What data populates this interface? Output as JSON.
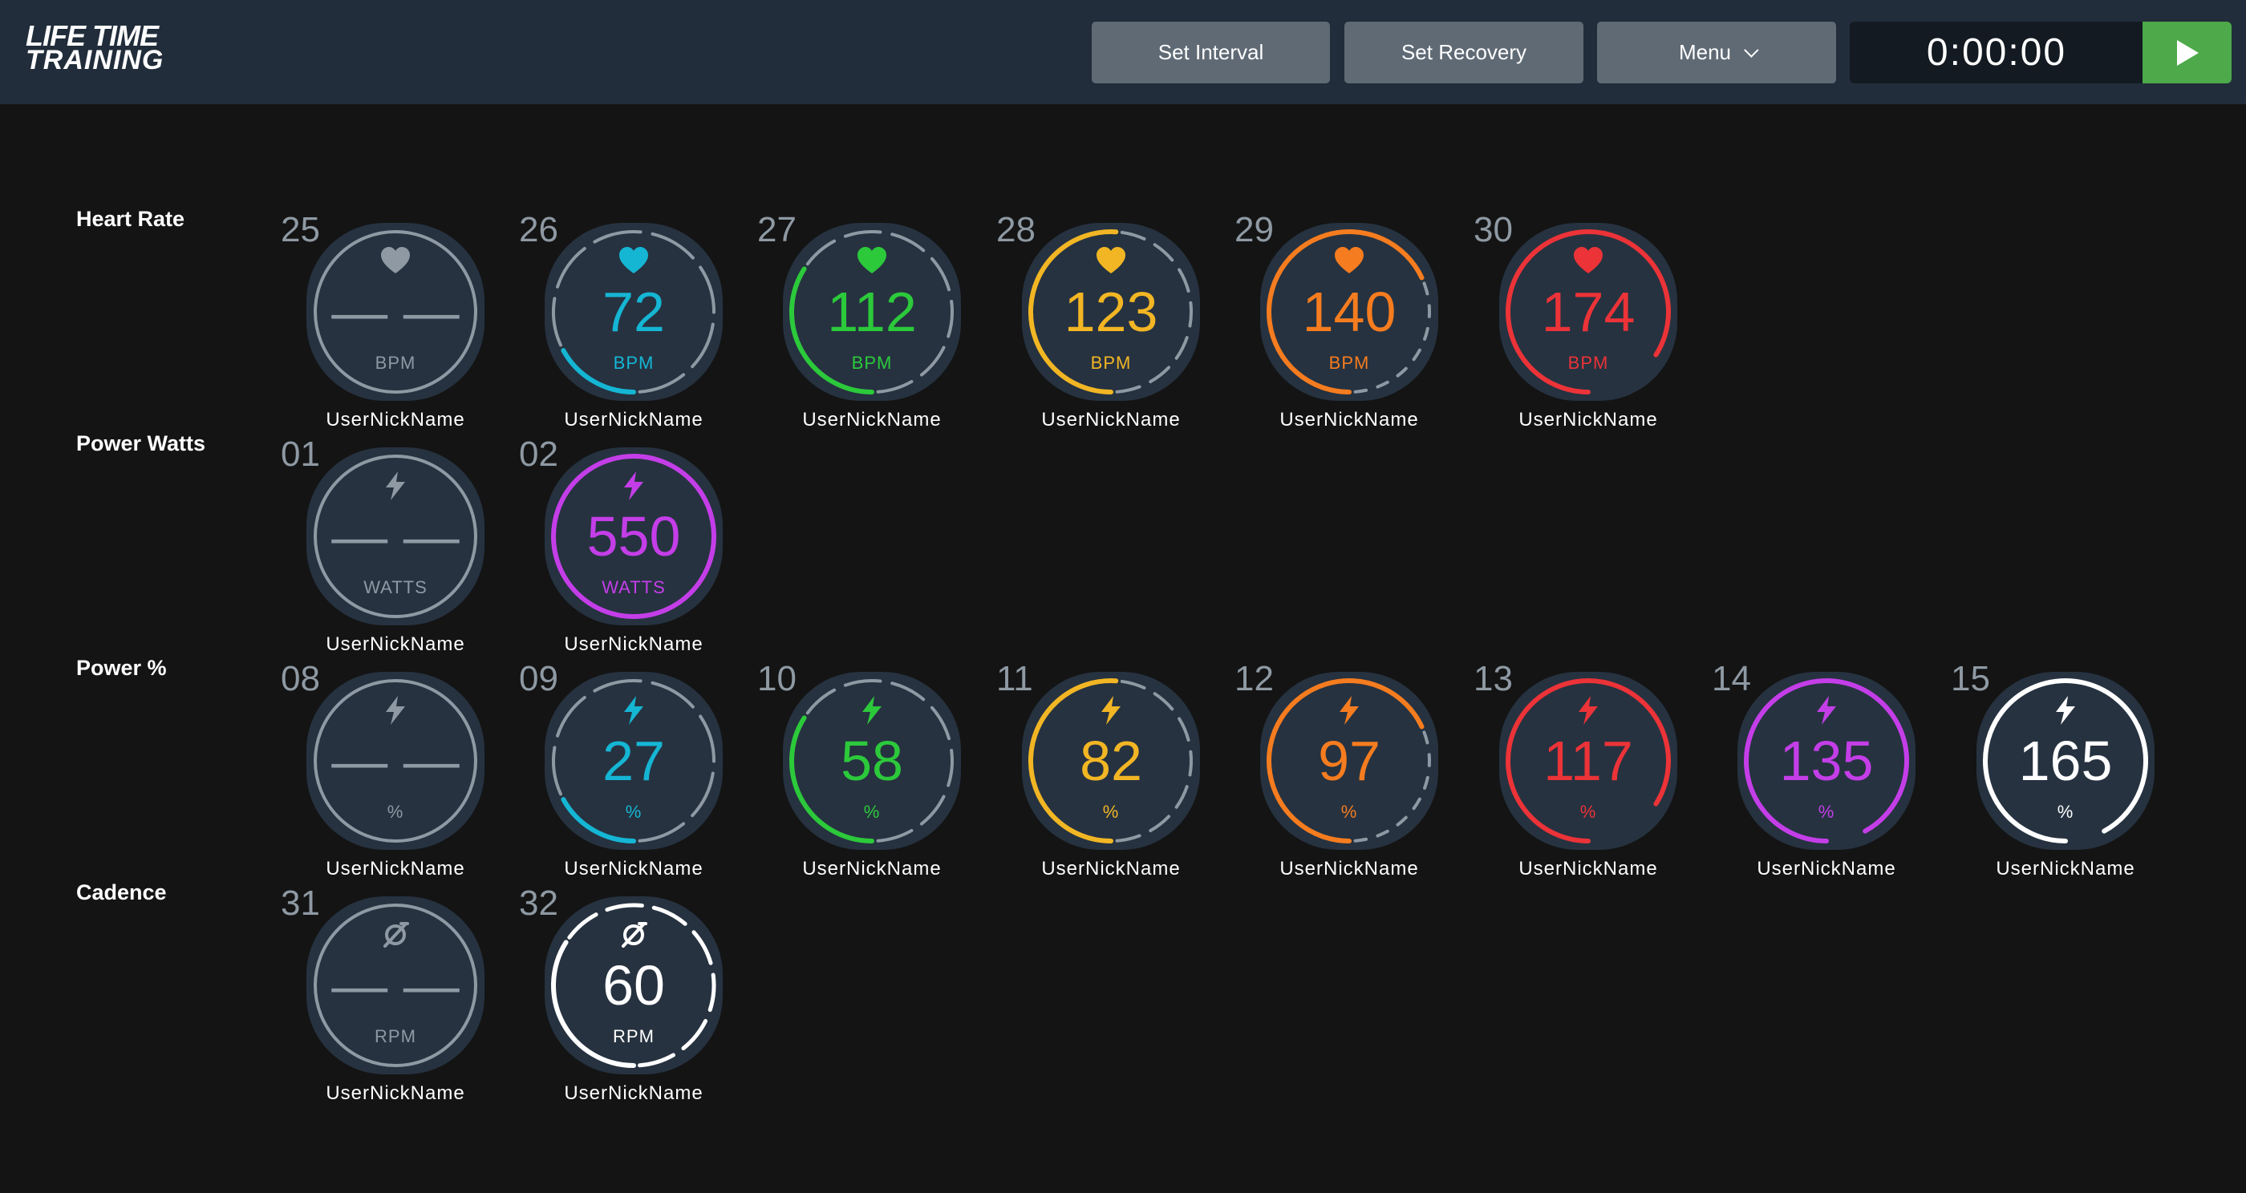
{
  "header": {
    "logo_line1": "LIFE TIME",
    "logo_line2": "TRAINING",
    "set_interval_label": "Set Interval",
    "set_recovery_label": "Set Recovery",
    "menu_label": "Menu",
    "timer": "0:00:00"
  },
  "colors": {
    "topbar": "#212d3a",
    "background": "#141414",
    "gray": "#8e99a3",
    "blue": "#15b6d4",
    "green": "#2cc93b",
    "yellow": "#f2b624",
    "orange": "#f57c1f",
    "red": "#eb3338",
    "purple": "#c43ee8",
    "white": "#ffffff",
    "play": "#4da94a"
  },
  "rows": [
    {
      "label": "Heart Rate",
      "icon": "heart-icon",
      "tiles": [
        {
          "number": "25",
          "value": "— —",
          "unit": "BPM",
          "name": "UserNickName",
          "color": "gray",
          "progress": 0
        },
        {
          "number": "26",
          "value": "72",
          "unit": "BPM",
          "name": "UserNickName",
          "color": "blue",
          "progress": 0.17
        },
        {
          "number": "27",
          "value": "112",
          "unit": "BPM",
          "name": "UserNickName",
          "color": "green",
          "progress": 0.34
        },
        {
          "number": "28",
          "value": "123",
          "unit": "BPM",
          "name": "UserNickName",
          "color": "yellow",
          "progress": 0.51
        },
        {
          "number": "29",
          "value": "140",
          "unit": "BPM",
          "name": "UserNickName",
          "color": "orange",
          "progress": 0.68
        },
        {
          "number": "30",
          "value": "174",
          "unit": "BPM",
          "name": "UserNickName",
          "color": "red",
          "progress": 0.84
        }
      ]
    },
    {
      "label": "Power Watts",
      "icon": "lightning-icon",
      "tiles": [
        {
          "number": "01",
          "value": "— —",
          "unit": "WATTS",
          "name": "UserNickName",
          "color": "gray",
          "progress": 0
        },
        {
          "number": "02",
          "value": "550",
          "unit": "WATTS",
          "name": "UserNickName",
          "color": "purple",
          "progress": 1
        }
      ]
    },
    {
      "label": "Power %",
      "icon": "lightning-icon",
      "tiles": [
        {
          "number": "08",
          "value": "— —",
          "unit": "%",
          "name": "UserNickName",
          "color": "gray",
          "progress": 0
        },
        {
          "number": "09",
          "value": "27",
          "unit": "%",
          "name": "UserNickName",
          "color": "blue",
          "progress": 0.17
        },
        {
          "number": "10",
          "value": "58",
          "unit": "%",
          "name": "UserNickName",
          "color": "green",
          "progress": 0.34
        },
        {
          "number": "11",
          "value": "82",
          "unit": "%",
          "name": "UserNickName",
          "color": "yellow",
          "progress": 0.51
        },
        {
          "number": "12",
          "value": "97",
          "unit": "%",
          "name": "UserNickName",
          "color": "orange",
          "progress": 0.68
        },
        {
          "number": "13",
          "value": "117",
          "unit": "%",
          "name": "UserNickName",
          "color": "red",
          "progress": 0.84
        },
        {
          "number": "14",
          "value": "135",
          "unit": "%",
          "name": "UserNickName",
          "color": "purple",
          "progress": 0.92
        },
        {
          "number": "15",
          "value": "165",
          "unit": "%",
          "name": "UserNickName",
          "color": "white",
          "progress": 0.92
        }
      ]
    },
    {
      "label": "Cadence",
      "icon": "cadence-icon",
      "tiles": [
        {
          "number": "31",
          "value": "— —",
          "unit": "RPM",
          "name": "UserNickName",
          "color": "gray",
          "progress": 0
        },
        {
          "number": "32",
          "value": "60",
          "unit": "RPM",
          "name": "UserNickName",
          "color": "white",
          "progress": 0.34
        }
      ]
    }
  ]
}
